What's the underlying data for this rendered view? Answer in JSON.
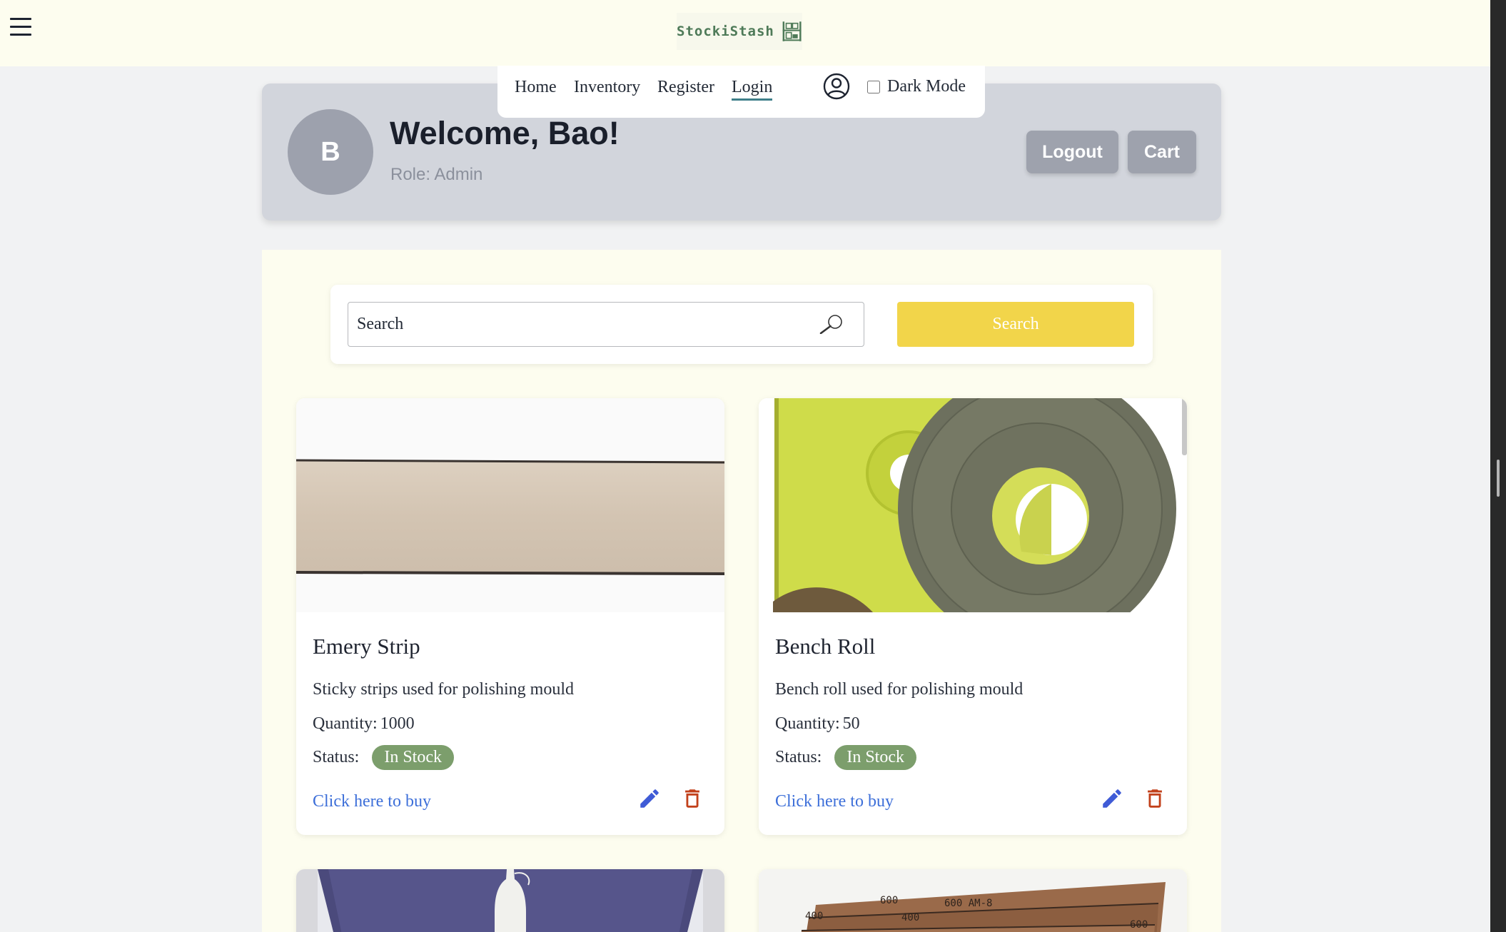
{
  "app": {
    "brand": "StockiStash",
    "menu_icon": "hamburger-menu-icon",
    "logo_icon": "warehouse-shelves-icon"
  },
  "nav": {
    "links": [
      {
        "label": "Home"
      },
      {
        "label": "Inventory"
      },
      {
        "label": "Register"
      },
      {
        "label": "Login",
        "active": true
      }
    ],
    "account_icon": "user-circle-icon",
    "dark_mode": {
      "label": "Dark Mode",
      "checked": false
    }
  },
  "welcome": {
    "avatar_initial": "B",
    "title": "Welcome, Bao!",
    "role": "Role: Admin",
    "logout_label": "Logout",
    "cart_label": "Cart"
  },
  "search": {
    "placeholder": "Search",
    "value": "",
    "button_label": "Search",
    "icon": "magnifier-icon"
  },
  "products": [
    {
      "name": "Emery Strip",
      "description": "Sticky strips used for polishing mould",
      "quantity_label": "Quantity:",
      "quantity": "1000",
      "status_label": "Status:",
      "status": "In Stock",
      "buy_label": "Click here to buy",
      "image": "emery-strip-photo"
    },
    {
      "name": "Bench Roll",
      "description": "Bench roll used for polishing mould",
      "quantity_label": "Quantity:",
      "quantity": "50",
      "status_label": "Status:",
      "status": "In Stock",
      "buy_label": "Click here to buy",
      "image": "bench-roll-photo"
    },
    {
      "image": "bottle-product-photo"
    },
    {
      "image": "abrasive-sticks-photo",
      "image_text": [
        "600",
        "600 AM-8",
        "400",
        "400",
        "600"
      ]
    }
  ],
  "colors": {
    "topbar_bg": "#fdfdef",
    "page_bg": "#f1f2f3",
    "welcome_bg": "#d2d5dc",
    "button_gray": "#9ea2ad",
    "search_button": "#f2d54a",
    "status_badge": "#7c9e6c",
    "link_blue": "#3d6fd9",
    "edit_icon": "#3f5bd6",
    "delete_icon": "#c2411b"
  }
}
